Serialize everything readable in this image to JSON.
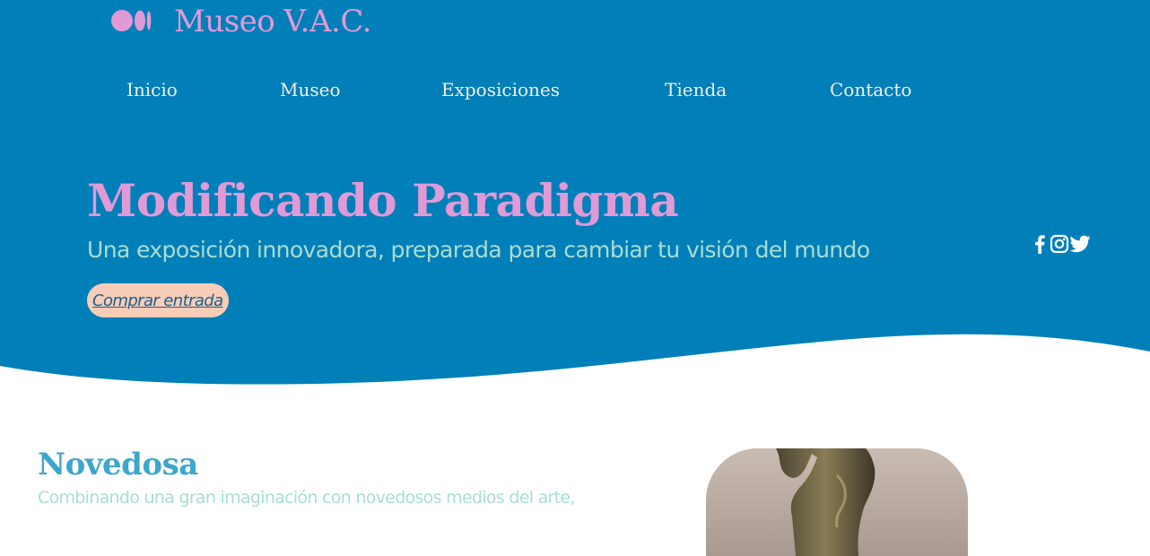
{
  "colors": {
    "hero_bg": "#007fb8",
    "accent_pink": "#e09ad6",
    "mint_text": "#a9ddd3",
    "nav_text": "#f3eee6",
    "button_bg": "#f8cdb8",
    "button_text": "#1d5d8c",
    "section_title": "#3da6cc"
  },
  "header": {
    "logo_icon": "medium-logo-icon",
    "title": "Museo V.A.C."
  },
  "nav": {
    "items": [
      {
        "label": "Inicio"
      },
      {
        "label": "Museo"
      },
      {
        "label": "Exposiciones"
      },
      {
        "label": "Tienda"
      },
      {
        "label": "Contacto"
      }
    ]
  },
  "hero": {
    "title": "Modificando Paradigma",
    "subtitle": "Una exposición innovadora, preparada para cambiar tu visión del mundo",
    "cta_label": "Comprar entrada"
  },
  "social": {
    "icons": [
      "facebook-icon",
      "instagram-icon",
      "twitter-icon"
    ]
  },
  "section": {
    "title": "Novedosa",
    "text": "Combinando una gran imaginación con novedosos medios del arte,"
  }
}
